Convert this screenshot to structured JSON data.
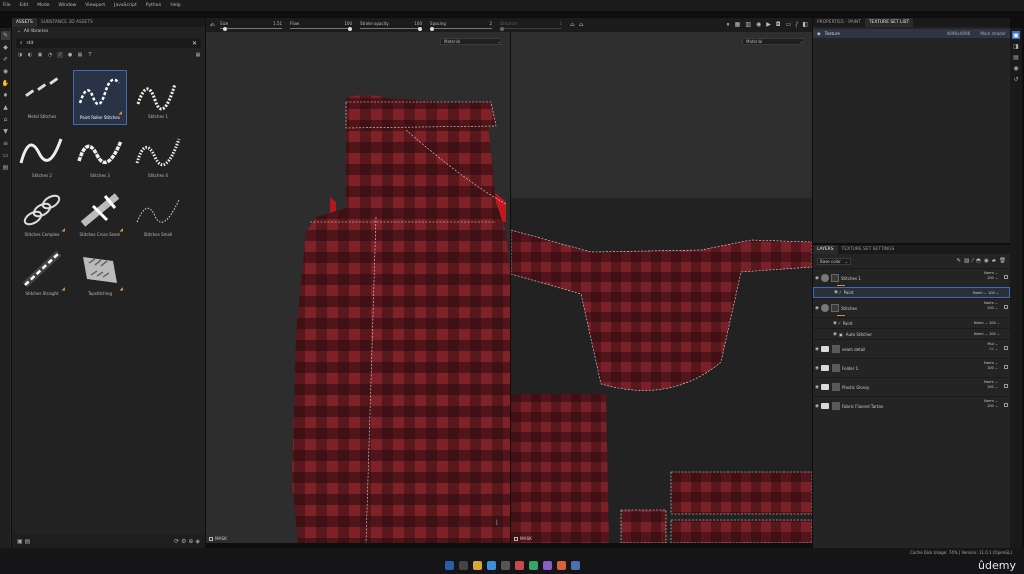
{
  "menubar": [
    "File",
    "Edit",
    "Mode",
    "Window",
    "Viewport",
    "JavaScript",
    "Python",
    "Help"
  ],
  "assets": {
    "tabs": [
      "ASSETS",
      "SUBSTANCE 3D ASSETS"
    ],
    "library": "All libraries",
    "search_value": "stit",
    "items": [
      {
        "label": "Metal Stitches",
        "icon": "metal-stitches-thumb",
        "badge": false
      },
      {
        "label": "Paint Roller Stitches",
        "icon": "paint-roller-stitches-thumb",
        "badge": true,
        "selected": true
      },
      {
        "label": "Stitches 1",
        "icon": "stitches-1-thumb",
        "badge": false
      },
      {
        "label": "Stitches 2",
        "icon": "stitches-2-thumb",
        "badge": false
      },
      {
        "label": "Stitches 3",
        "icon": "stitches-3-thumb",
        "badge": false
      },
      {
        "label": "Stitches 4",
        "icon": "stitches-4-thumb",
        "badge": false
      },
      {
        "label": "Stitches Complex",
        "icon": "stitches-complex-thumb",
        "badge": true
      },
      {
        "label": "Stitches Cross Seam",
        "icon": "stitches-cross-seam-thumb",
        "badge": true
      },
      {
        "label": "Stitches Small",
        "icon": "stitches-small-thumb",
        "badge": false
      },
      {
        "label": "Stitches Straight",
        "icon": "stitches-straight-thumb",
        "badge": true
      },
      {
        "label": "Topstitching",
        "icon": "topstitching-thumb",
        "badge": true
      }
    ]
  },
  "toolbar": {
    "size_label": "Size",
    "size_value": "1.51",
    "flow_label": "Flow",
    "flow_value": "100",
    "stroke_opacity_label": "Stroke opacity",
    "stroke_opacity_value": "100",
    "spacing_label": "Spacing",
    "spacing_value": "2",
    "distance_label": "Distance",
    "distance_value": "1"
  },
  "viewports": {
    "left_select": "Material",
    "right_select": "Material",
    "mask_label": "MASK"
  },
  "properties": {
    "tabs": [
      "PROPERTIES - PAINT",
      "TEXTURE SET LIST"
    ],
    "texture_set": {
      "name": "Texture",
      "resolution": "4096x4096",
      "shader": "Main shader"
    }
  },
  "layers": {
    "tabs": [
      "LAYERS",
      "TEXTURE SET SETTINGS"
    ],
    "channel": "Base color",
    "rows": [
      {
        "name": "Stitches 1",
        "type": "layer",
        "blend": "Norm",
        "opacity": "100"
      },
      {
        "name": "Paint",
        "type": "effect",
        "blend": "Norm",
        "opacity": "100",
        "selected": true
      },
      {
        "name": "Stitches",
        "type": "layer",
        "blend": "Norm",
        "opacity": "100"
      },
      {
        "name": "Paint",
        "type": "effect",
        "blend": "Norm",
        "opacity": "100"
      },
      {
        "name": "Auto Stitcher",
        "type": "effect",
        "blend": "Norm",
        "opacity": "100"
      },
      {
        "name": "seam detail",
        "type": "folder",
        "blend": "Mul",
        "opacity": "34"
      },
      {
        "name": "Folder 1",
        "type": "folder",
        "blend": "Norm",
        "opacity": "100"
      },
      {
        "name": "Plastic Glossy",
        "type": "folder",
        "blend": "Norm",
        "opacity": "100"
      },
      {
        "name": "Fabric Flannel Tartan",
        "type": "folder",
        "blend": "Norm",
        "opacity": "100"
      }
    ]
  },
  "statusbar": {
    "text": "Cache Disk Usage: 74% | Version: 11.0.1 (OpenGL)"
  },
  "watermark": "ûdemy",
  "colors": {
    "accent": "#3d6db5",
    "orange": "#e08a2b",
    "fabric_red": "#7a1e24",
    "fabric_dark": "#2a0c10"
  }
}
